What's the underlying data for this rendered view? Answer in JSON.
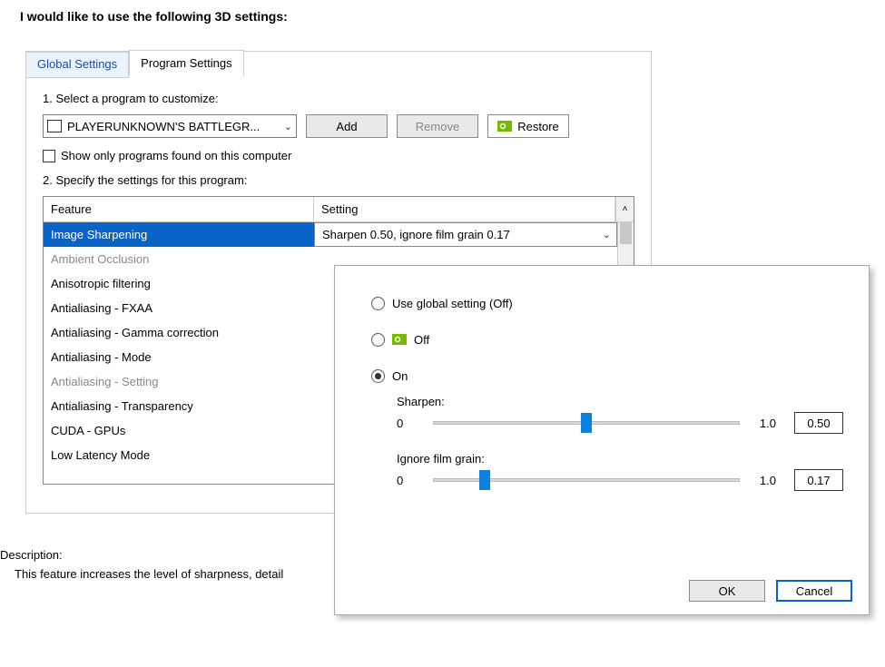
{
  "title": "I would like to use the following 3D settings:",
  "tabs": {
    "global": "Global Settings",
    "program": "Program Settings"
  },
  "section1": "1. Select a program to customize:",
  "program_selected": "PLAYERUNKNOWN'S BATTLEGR...",
  "buttons": {
    "add": "Add",
    "remove": "Remove",
    "restore": "Restore"
  },
  "checkbox_label": "Show only programs found on this computer",
  "section2": "2. Specify the settings for this program:",
  "table_headers": {
    "feature": "Feature",
    "setting": "Setting"
  },
  "features": [
    {
      "name": "Image Sharpening",
      "setting": "Sharpen 0.50, ignore film grain 0.17",
      "selected": true
    },
    {
      "name": "Ambient Occlusion",
      "dimmed": true
    },
    {
      "name": "Anisotropic filtering"
    },
    {
      "name": "Antialiasing - FXAA"
    },
    {
      "name": "Antialiasing - Gamma correction"
    },
    {
      "name": "Antialiasing - Mode"
    },
    {
      "name": "Antialiasing - Setting",
      "dimmed": true
    },
    {
      "name": "Antialiasing - Transparency"
    },
    {
      "name": "CUDA - GPUs"
    },
    {
      "name": "Low Latency Mode"
    }
  ],
  "description": {
    "heading": "Description:",
    "text": "This feature increases the level of sharpness, detail"
  },
  "popup": {
    "option_global": "Use global setting (Off)",
    "option_off": "Off",
    "option_on": "On",
    "sharpen_label": "Sharpen:",
    "grain_label": "Ignore film grain:",
    "min": "0",
    "max": "1.0",
    "sharpen_value": "0.50",
    "grain_value": "0.17",
    "ok": "OK",
    "cancel": "Cancel"
  }
}
